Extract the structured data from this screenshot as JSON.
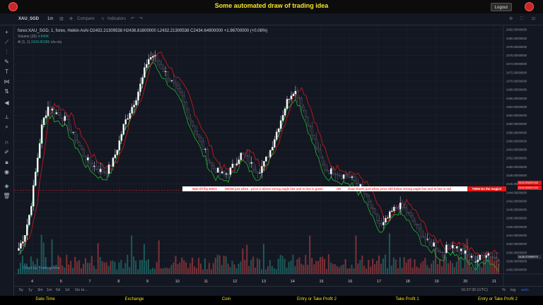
{
  "header": {
    "title": "Some automated draw of trading idea",
    "logout_label": "Logout"
  },
  "toolbar": {
    "symbol": "XAU_SGD",
    "interval": "1m",
    "compare_label": "Compare",
    "indicators_label": "Indicators"
  },
  "legend": {
    "main": "forex:XAU_SGD, 1, forex, Heikin Ashi",
    "ohlc": "O2432.21309538  H2436.81600000  L2432.21309538  C2434.64900000  +1.96700000 (+0.08%)",
    "volume": "Volume (20)",
    "volume_val": "4.840K",
    "al": "Al (1, 1)",
    "al_val": "2429.80386",
    "na1": "n/a",
    "na2": "n/a"
  },
  "price_axis": [
    "2482.00000000",
    "2480.00000000",
    "2478.00000000",
    "2476.00000000",
    "2474.00000000",
    "2472.00000000",
    "2470.00000000",
    "2468.00000000",
    "2466.00000000",
    "2464.00000000",
    "2462.00000000",
    "2460.00000000",
    "2458.00000000",
    "2456.00000000",
    "2454.00000000",
    "2452.00000000",
    "2450.00000000",
    "2448.00000000",
    "2446.00000000",
    "2444.00000000",
    "2442.00000000",
    "2440.00000000",
    "2438.00000000",
    "2436.00000000",
    "2434.00000000",
    "2432.00000000",
    "2430.00000000",
    "2428.00000000",
    "2426.00000000"
  ],
  "price_tags": {
    "tag1": "2444.53622148",
    "tag2": "2444.53622148",
    "tag3": "2428.37699975"
  },
  "date_axis": [
    "4",
    "5",
    "7",
    "8",
    "9",
    "10",
    "11",
    "12",
    "13",
    "14",
    "15",
    "16",
    "17",
    "18",
    "19",
    "20",
    "21"
  ],
  "annotations": {
    "a1": "Wait till flip ENDS ↑",
    "a2": "DRAW just when : price is above strong angle line and AI line is green",
    "a3": "OR",
    "a4": "draw shorts just when price still below strong angle line and AI line is red",
    "a5": "THEN Do the magic!!"
  },
  "watermark": "Chart by TradingView",
  "timeframes": [
    "5y",
    "1y",
    "3m",
    "1m",
    "5d",
    "1d",
    "Go to..."
  ],
  "bottom_right": {
    "time": "16:37:30 (UTC)",
    "pct": "%",
    "log": "log",
    "auto": "auto"
  },
  "footer": {
    "cols": [
      "Date Time",
      "Exchange",
      "Coin",
      "Entry or Take Profit 2",
      "Take Profit 1",
      "Entry or Take Profit 2"
    ]
  },
  "colors": {
    "accent": "#f5e52a",
    "up": "#26a69a",
    "down": "#ef5350",
    "ai_green": "#1fa82e",
    "ai_red": "#c0181a"
  },
  "chart_data": {
    "type": "candlestick",
    "series_name": "forex:XAU_SGD",
    "close_path": [
      2431,
      2434,
      2440,
      2450,
      2460,
      2464,
      2463,
      2462,
      2461,
      2458,
      2456,
      2453,
      2451,
      2450,
      2449,
      2449,
      2451,
      2455,
      2460,
      2463,
      2466,
      2470,
      2475,
      2476,
      2474,
      2472,
      2470,
      2468,
      2466,
      2462,
      2459,
      2456,
      2453,
      2450,
      2449,
      2448,
      2449,
      2451,
      2453,
      2452,
      2450,
      2449,
      2451,
      2454,
      2458,
      2462,
      2466,
      2468,
      2466,
      2462,
      2458,
      2454,
      2450,
      2449,
      2449,
      2448,
      2448,
      2447,
      2446,
      2444,
      2441,
      2438,
      2436,
      2438,
      2440,
      2441,
      2440,
      2438,
      2436,
      2434,
      2432,
      2432,
      2430,
      2431,
      2432,
      2431,
      2430,
      2429,
      2428,
      2429,
      2430,
      2429,
      2428
    ],
    "ylim": [
      2425,
      2483
    ]
  }
}
